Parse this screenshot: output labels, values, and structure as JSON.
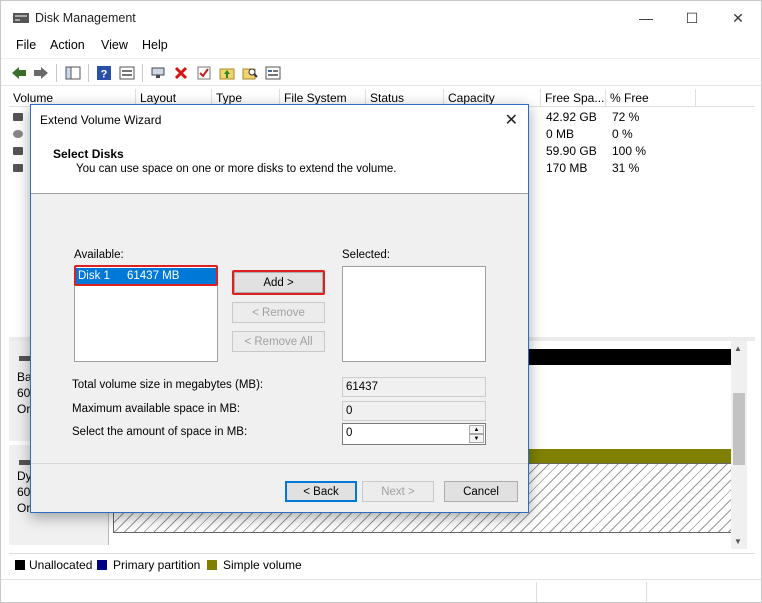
{
  "window": {
    "title": "Disk Management",
    "minimize": "—",
    "maximize": "☐",
    "close": "✕"
  },
  "menu": [
    "File",
    "Action",
    "View",
    "Help"
  ],
  "columns": [
    "Volume",
    "Layout",
    "Type",
    "File System",
    "Status",
    "Capacity",
    "Free Spa...",
    "% Free"
  ],
  "volumes": [
    {
      "free": "42.92 GB",
      "pct": "72 %"
    },
    {
      "free": "0 MB",
      "pct": "0 %"
    },
    {
      "free": "59.90 GB",
      "pct": "100 %"
    },
    {
      "free": "170 MB",
      "pct": "31 %"
    }
  ],
  "disks": [
    {
      "line1": "Ba",
      "line2": "60.",
      "line3": "Or"
    },
    {
      "line1": "Dy",
      "line2": "60.",
      "line3": "Or"
    }
  ],
  "legend": [
    {
      "label": "Unallocated",
      "color": "#000000"
    },
    {
      "label": "Primary partition",
      "color": "#000080"
    },
    {
      "label": "Simple volume",
      "color": "#808000"
    }
  ],
  "colors": {
    "unallocated": "#000000",
    "simple_volume": "#808000",
    "dialog_border": "#2b6cc4",
    "selection": "#0078d7"
  },
  "dialog": {
    "title": "Extend Volume Wizard",
    "close": "✕",
    "heading": "Select Disks",
    "subheading": "You can use space on one or more disks to extend the volume.",
    "available_label": "Available:",
    "selected_label": "Selected:",
    "available_items": [
      {
        "name": "Disk 1",
        "size": "61437 MB"
      }
    ],
    "add_label": "Add >",
    "remove_label": "< Remove",
    "remove_all_label": "< Remove All",
    "total_label": "Total volume size in megabytes (MB):",
    "total_value": "61437",
    "max_label": "Maximum available space in MB:",
    "max_value": "0",
    "amount_label": "Select the amount of space in MB:",
    "amount_value": "0",
    "back_label": "< Back",
    "next_label": "Next >",
    "cancel_label": "Cancel"
  }
}
